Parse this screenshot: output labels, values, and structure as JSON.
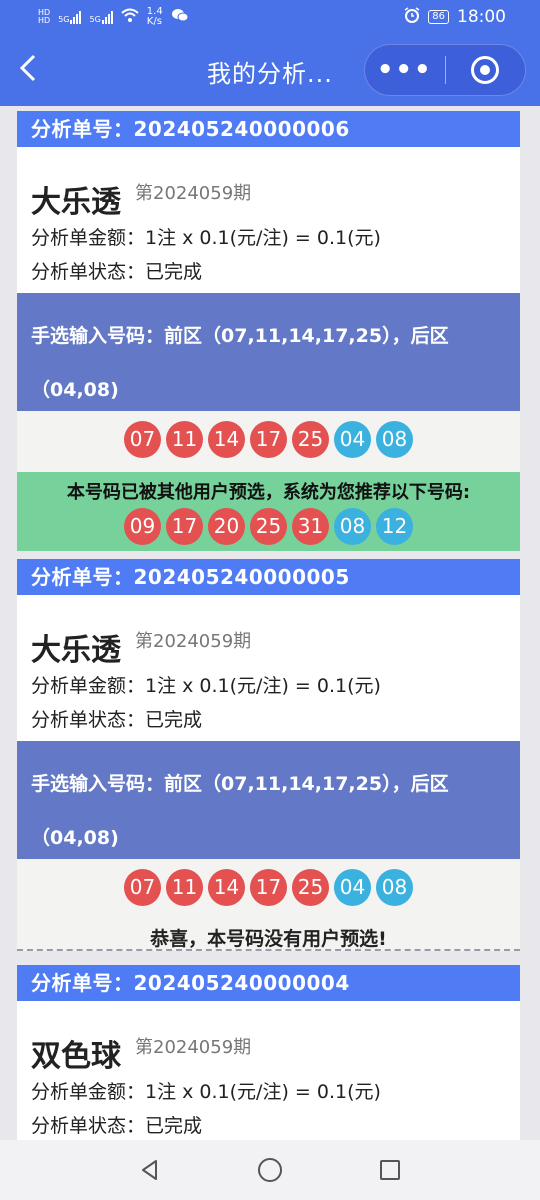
{
  "status": {
    "hd1": "HD",
    "hd2": "HD",
    "sig1": "5G",
    "sig2": "5G",
    "speed_value": "1.4",
    "speed_unit": "K/s",
    "battery": "86",
    "time": "18:00"
  },
  "nav": {
    "title": "我的分析...",
    "more": "•••"
  },
  "cards": [
    {
      "order_label": "分析单号：202405240000006",
      "lottery": "大乐透",
      "period": "第2024059期",
      "amount": "分析单金额：1注 x 0.1(元/注) = 0.1(元)",
      "status": "分析单状态：已完成",
      "manual_line1": "手选输入号码：前区（07,11,14,17,25），后区",
      "manual_line2": "（04,08)",
      "balls": [
        {
          "n": "07",
          "c": "red"
        },
        {
          "n": "11",
          "c": "red"
        },
        {
          "n": "14",
          "c": "red"
        },
        {
          "n": "17",
          "c": "red"
        },
        {
          "n": "25",
          "c": "red"
        },
        {
          "n": "04",
          "c": "blue"
        },
        {
          "n": "08",
          "c": "blue"
        }
      ],
      "recommend_text": "本号码已被其他用户预选，系统为您推荐以下号码:",
      "recommend_balls": [
        {
          "n": "09",
          "c": "red"
        },
        {
          "n": "17",
          "c": "red"
        },
        {
          "n": "20",
          "c": "red"
        },
        {
          "n": "25",
          "c": "red"
        },
        {
          "n": "31",
          "c": "red"
        },
        {
          "n": "08",
          "c": "blue"
        },
        {
          "n": "12",
          "c": "blue"
        }
      ]
    },
    {
      "order_label": "分析单号：202405240000005",
      "lottery": "大乐透",
      "period": "第2024059期",
      "amount": "分析单金额：1注 x 0.1(元/注) = 0.1(元)",
      "status": "分析单状态：已完成",
      "manual_line1": "手选输入号码：前区（07,11,14,17,25），后区",
      "manual_line2": "（04,08)",
      "balls": [
        {
          "n": "07",
          "c": "red"
        },
        {
          "n": "11",
          "c": "red"
        },
        {
          "n": "14",
          "c": "red"
        },
        {
          "n": "17",
          "c": "red"
        },
        {
          "n": "25",
          "c": "red"
        },
        {
          "n": "04",
          "c": "blue"
        },
        {
          "n": "08",
          "c": "blue"
        }
      ],
      "congrats_text": "恭喜，本号码没有用户预选!"
    },
    {
      "order_label": "分析单号：202405240000004",
      "lottery": "双色球",
      "period": "第2024059期",
      "amount": "分析单金额：1注 x 0.1(元/注) = 0.1(元)",
      "status": "分析单状态：已完成"
    }
  ],
  "colors": {
    "header": "#4a72e8",
    "card_head": "#4f7cf4",
    "manual_bg": "#6378c6",
    "red_ball": "#e35151",
    "blue_ball": "#3bb1df",
    "recommend_bg": "#76d19a"
  }
}
